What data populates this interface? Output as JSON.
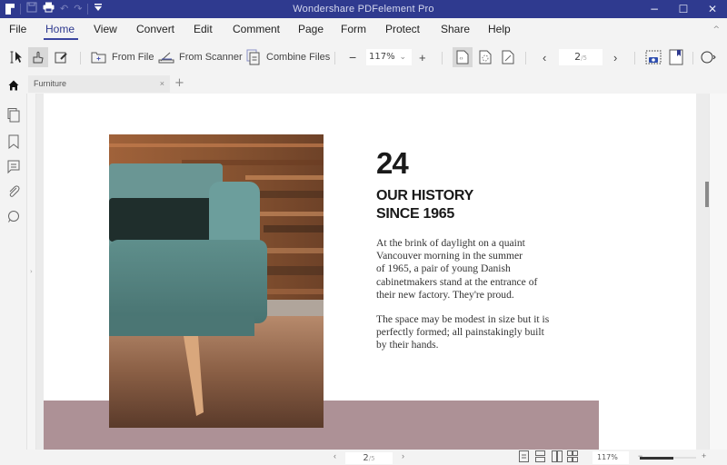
{
  "window": {
    "title": "Wondershare PDFelement Pro",
    "quick_access": [
      "app-logo",
      "save-icon",
      "print-icon",
      "undo-icon",
      "redo-icon",
      "customize-icon"
    ],
    "controls": {
      "minimize": "−",
      "maximize": "☐",
      "close": "✕"
    }
  },
  "menu": {
    "items": [
      "File",
      "Home",
      "View",
      "Convert",
      "Edit",
      "Comment",
      "Page",
      "Form",
      "Protect",
      "Share",
      "Help"
    ],
    "active": "Home",
    "collapse_glyph": "^"
  },
  "toolbar": {
    "from_file": "From File",
    "from_scanner": "From Scanner",
    "combine_files": "Combine Files",
    "zoom_out": "−",
    "zoom_value": "117%",
    "zoom_caret": "⌄",
    "zoom_in": "+",
    "prev": "‹",
    "next": "›",
    "page_current": "2",
    "page_total": "/5"
  },
  "tabs": {
    "items": [
      {
        "label": "Furniture",
        "close": "×"
      }
    ],
    "add": "+"
  },
  "document": {
    "number": "24",
    "heading_line1": "OUR HISTORY",
    "heading_line2": "SINCE 1965",
    "paragraph1": [
      "At the brink of daylight on a quaint",
      "Vancouver morning in the summer",
      "of 1965, a pair of young Danish",
      "cabinetmakers stand at the entrance of",
      "their new factory. They're proud."
    ],
    "paragraph2": [
      "The space may be modest in size but it is",
      "perfectly formed; all painstakingly built",
      "by their hands."
    ],
    "photo_alt": "teal armchair against reclaimed wood wall",
    "band_color": "#ad9196"
  },
  "statusbar": {
    "prev": "‹",
    "next": "›",
    "page_current": "2",
    "page_total": "/5",
    "zoom_value": "117%",
    "zoom_out": "−",
    "zoom_in": "+",
    "zoom_slider_fraction": 0.6
  },
  "colors": {
    "titlebar": "#2f3a8f",
    "accent": "#3a45a0"
  }
}
